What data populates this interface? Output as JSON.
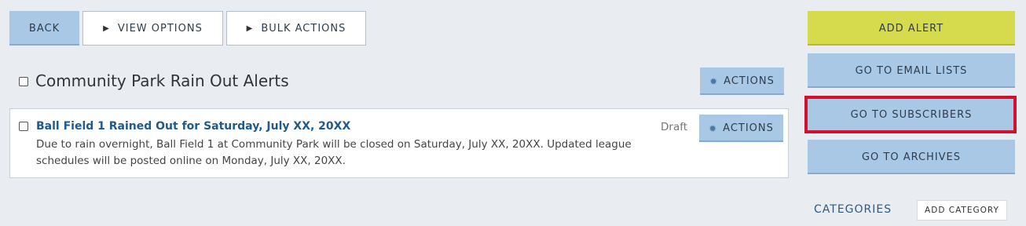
{
  "toolbar": {
    "back": "BACK",
    "view_options": "VIEW OPTIONS",
    "bulk_actions": "BULK ACTIONS"
  },
  "list": {
    "title": "Community Park Rain Out Alerts",
    "actions_label": "ACTIONS"
  },
  "alert": {
    "title": "Ball Field 1 Rained Out for Saturday, July XX, 20XX",
    "body": "Due to rain overnight, Ball Field 1 at Community Park will be closed on Saturday, July XX, 20XX. Updated league schedules will be posted online on Monday, July XX, 20XX.",
    "status": "Draft",
    "actions_label": "ACTIONS"
  },
  "sidebar": {
    "add_alert": "ADD ALERT",
    "email_lists": "GO TO EMAIL LISTS",
    "subscribers": "GO TO SUBSCRIBERS",
    "archives": "GO TO ARCHIVES",
    "categories": "CATEGORIES",
    "add_category": "ADD CATEGORY"
  },
  "colors": {
    "background": "#e9edf2",
    "button_blue": "#a9c8e6",
    "button_yellow": "#d6db4d",
    "highlight_red": "#d0122e",
    "link_blue": "#1e5a8e"
  },
  "icons": {
    "triangle": "play-triangle-icon",
    "gear": "gear-icon"
  }
}
